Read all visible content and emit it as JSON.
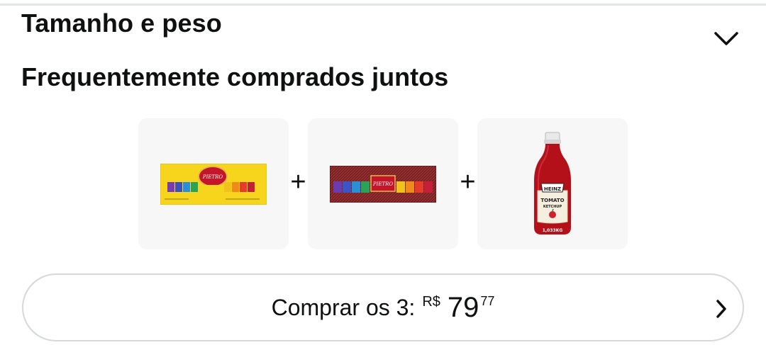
{
  "section": {
    "title": "Tamanho e peso",
    "expand_icon": "chevron-down-icon"
  },
  "frequently_bought": {
    "title": "Frequentemente comprados juntos",
    "products": [
      {
        "image": "chocolate-box-yellow-image",
        "brand_label": "PIETRO"
      },
      {
        "image": "chocolate-box-burgundy-image",
        "brand_label": "PIETRO"
      },
      {
        "image": "ketchup-bottle-image",
        "brand_label": "HEINZ",
        "product_label_1": "TOMATO",
        "product_label_2": "KETCHUP",
        "weight_label": "1,033KG"
      }
    ],
    "plus_sign": "+",
    "buy_button": {
      "label": "Comprar os 3:",
      "currency": "R$",
      "price_whole": "79",
      "price_fraction": "77",
      "icon": "chevron-right-icon"
    }
  },
  "colors": {
    "divider": "#e3e6e6",
    "tile_bg": "#f7f7f7",
    "button_border": "#d5d9d9",
    "text": "#0f1111"
  }
}
